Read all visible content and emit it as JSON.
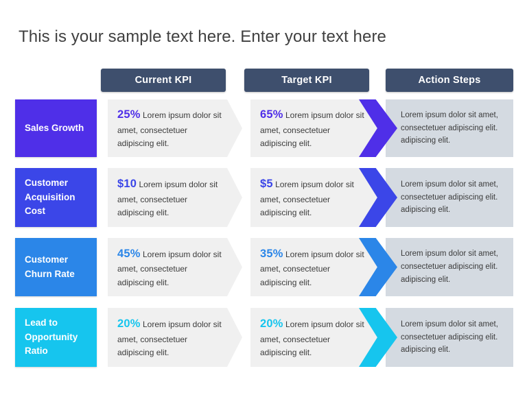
{
  "slide": {
    "title": "This is your sample text here. Enter your text here",
    "background": "#ffffff"
  },
  "columns": {
    "label_header": "",
    "headers": [
      {
        "id": "current-kpi",
        "label": "Current KPI"
      },
      {
        "id": "target-kpi",
        "label": "Target KPI"
      },
      {
        "id": "action-steps",
        "label": "Action Steps"
      }
    ],
    "header_bg": "#3e4f6d",
    "header_text_color": "#ffffff"
  },
  "rows": [
    {
      "id": "sales-growth",
      "label": "Sales Growth",
      "color": "#4f2fe8",
      "current": {
        "value": "25%",
        "text": "Lorem ipsum dolor sit amet, consectetuer adipiscing elit."
      },
      "target": {
        "value": "65%",
        "text": "Lorem ipsum dolor sit amet, consectetuer adipiscing elit."
      },
      "action": "Lorem ipsum dolor sit amet, consectetuer adipiscing elit. adipiscing elit."
    },
    {
      "id": "customer-acquisition-cost",
      "label": "Customer Acquisition Cost",
      "color": "#3b46e8",
      "current": {
        "value": "$10",
        "text": "Lorem ipsum dolor sit amet, consectetuer adipiscing elit."
      },
      "target": {
        "value": "$5",
        "text": "Lorem ipsum dolor sit amet, consectetuer adipiscing elit."
      },
      "action": "Lorem ipsum dolor sit amet, consectetuer adipiscing elit. adipiscing elit."
    },
    {
      "id": "customer-churn-rate",
      "label": "Customer Churn Rate",
      "color": "#2b86e8",
      "current": {
        "value": "45%",
        "text": "Lorem ipsum dolor sit amet, consectetuer adipiscing elit."
      },
      "target": {
        "value": "35%",
        "text": "Lorem ipsum dolor sit amet, consectetuer adipiscing elit."
      },
      "action": "Lorem ipsum dolor sit amet, consectetuer adipiscing elit. adipiscing elit."
    },
    {
      "id": "lead-to-opportunity-ratio",
      "label": "Lead to Opportunity Ratio",
      "color": "#16c5ee",
      "current": {
        "value": "20%",
        "text": "Lorem ipsum dolor sit amet, consectetuer adipiscing elit."
      },
      "target": {
        "value": "20%",
        "text": "Lorem ipsum dolor sit amet, consectetuer adipiscing elit."
      },
      "action": "Lorem ipsum dolor sit amet, consectetuer adipiscing elit. adipiscing elit."
    }
  ],
  "palette": {
    "panel_light": "#f0f0f0",
    "panel_action": "#d4dae1",
    "body_text": "#3b3b3b",
    "title_text": "#404040"
  }
}
